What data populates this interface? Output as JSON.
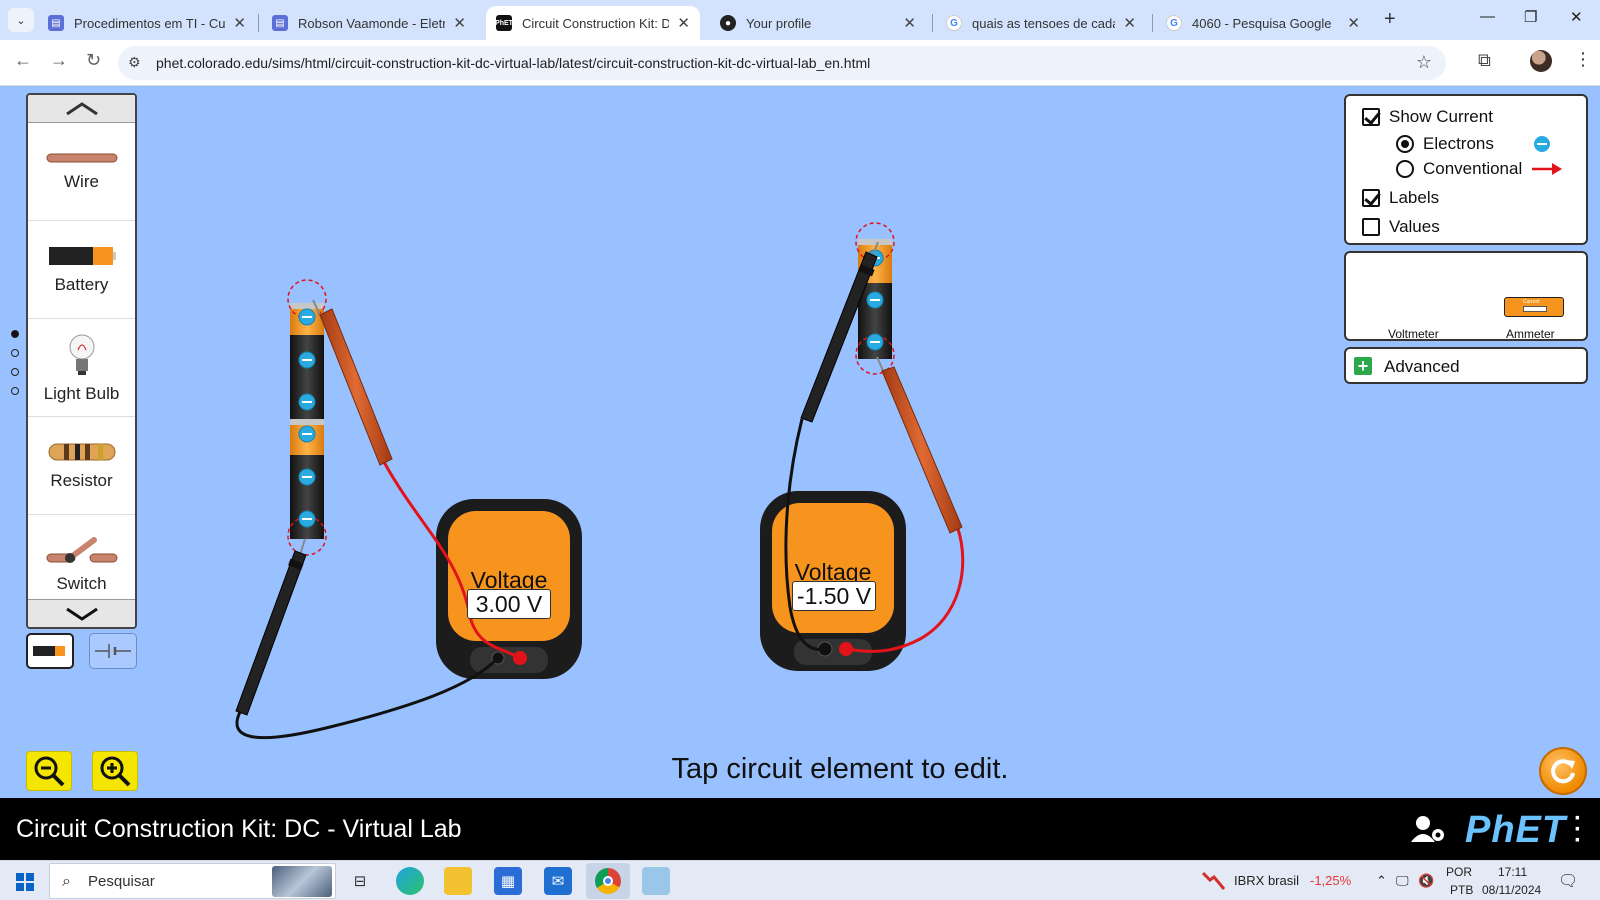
{
  "browser": {
    "tabs": [
      {
        "title": "Procedimentos em TI - Curso",
        "favicon": "forms-icon",
        "active": false
      },
      {
        "title": "Robson Vaamonde - Eletricid",
        "favicon": "forms-icon",
        "active": false
      },
      {
        "title": "Circuit Construction Kit: DC -",
        "favicon": "phet-icon",
        "active": true
      },
      {
        "title": "Your profile",
        "favicon": "github-icon",
        "active": false
      },
      {
        "title": "quais as tensoes de cada tipo",
        "favicon": "google-icon",
        "active": false
      },
      {
        "title": "4060 - Pesquisa Google",
        "favicon": "google-icon",
        "active": false
      }
    ],
    "url": "phet.colorado.edu/sims/html/circuit-construction-kit-dc-virtual-lab/latest/circuit-construction-kit-dc-virtual-lab_en.html"
  },
  "toolbox": {
    "items": [
      {
        "label": "Wire"
      },
      {
        "label": "Battery"
      },
      {
        "label": "Light Bulb"
      },
      {
        "label": "Resistor"
      },
      {
        "label": "Switch"
      }
    ],
    "page_dots": 4,
    "active_dot": 0
  },
  "controls": {
    "show_current": {
      "label": "Show Current",
      "checked": true
    },
    "electrons": {
      "label": "Electrons",
      "selected": true
    },
    "conventional": {
      "label": "Conventional",
      "selected": false
    },
    "labels": {
      "label": "Labels",
      "checked": true
    },
    "values": {
      "label": "Values",
      "checked": false
    }
  },
  "sensors": {
    "voltmeter_label": "Voltmeter",
    "ammeter_label": "Ammeter",
    "ammeter_screen_text": "Current"
  },
  "advanced": {
    "label": "Advanced"
  },
  "voltmeters": [
    {
      "title": "Voltage",
      "reading": "3.00 V"
    },
    {
      "title": "Voltage",
      "reading": "-1.50 V"
    }
  ],
  "hint": "Tap circuit element to edit.",
  "navbar": {
    "title": "Circuit Construction Kit: DC - Virtual Lab",
    "logo": "PhET"
  },
  "taskbar": {
    "search_placeholder": "Pesquisar",
    "stock_name": "IBRX brasil",
    "stock_change": "-1,25%",
    "lang_top": "POR",
    "lang_bottom": "PTB",
    "time": "17:11",
    "date": "08/11/2024"
  },
  "colors": {
    "sim_background": "#99c1ff",
    "probe_red": "#e2131a",
    "meter_orange": "#f7941d",
    "electron_blue": "#29aae1",
    "stock_negative": "#e53935"
  }
}
